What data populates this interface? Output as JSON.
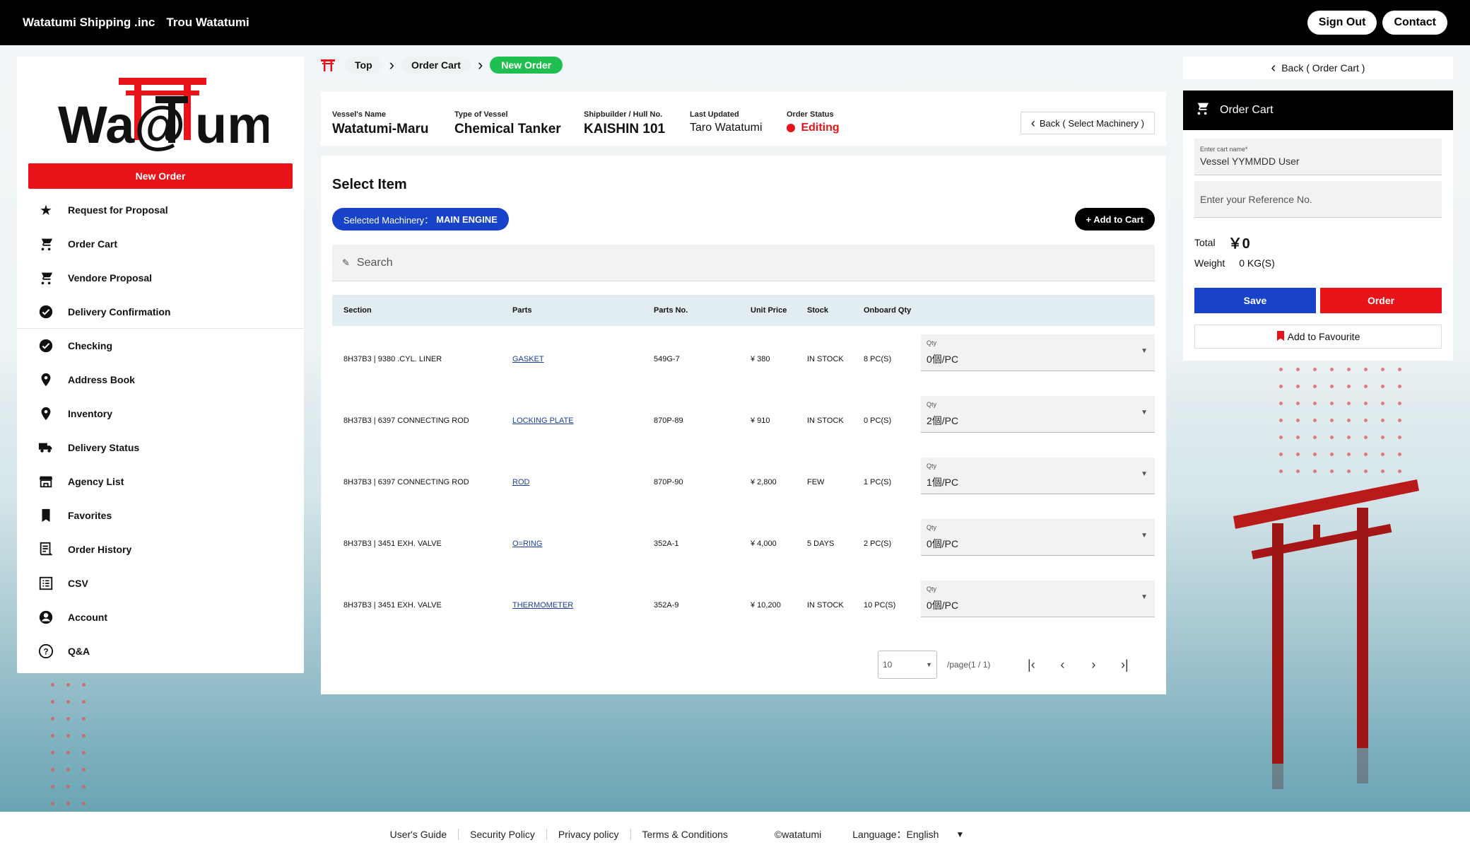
{
  "header": {
    "company": "Watatumi Shipping .inc",
    "user": "Trou Watatumi",
    "sign_out": "Sign Out",
    "contact": "Contact"
  },
  "sidebar": {
    "logo_text": "Wa@umi",
    "new_order": "New Order",
    "items": [
      {
        "label": "Request for Proposal",
        "icon": "star-icon"
      },
      {
        "label": "Order Cart",
        "icon": "cart-icon"
      },
      {
        "label": "Vendore Proposal",
        "icon": "cart-icon"
      },
      {
        "label": "Delivery Confirmation",
        "icon": "check-circle-icon"
      },
      {
        "label": "Checking",
        "icon": "check-circle-icon"
      },
      {
        "label": "Address Book",
        "icon": "location-pin-icon"
      },
      {
        "label": "Inventory",
        "icon": "location-pin-icon"
      },
      {
        "label": "Delivery Status",
        "icon": "truck-icon"
      },
      {
        "label": "Agency List",
        "icon": "store-icon"
      },
      {
        "label": "Favorites",
        "icon": "bookmark-icon"
      },
      {
        "label": "Order History",
        "icon": "receipt-icon"
      },
      {
        "label": "CSV",
        "icon": "list-icon"
      },
      {
        "label": "Account",
        "icon": "account-circle-icon"
      },
      {
        "label": "Q&A",
        "icon": "help-circle-icon"
      }
    ]
  },
  "breadcrumb": {
    "top": "Top",
    "order_cart": "Order Cart",
    "new_order": "New Order"
  },
  "vessel": {
    "name_label": "Vessel's Name",
    "name": "Watatumi-Maru",
    "type_label": "Type of Vessel",
    "type": "Chemical Tanker",
    "builder_label": "Shipbuilder / Hull No.",
    "builder": "KAISHIN 101",
    "updated_label": "Last Updated",
    "updated": "Taro Watatumi",
    "status_label": "Order Status",
    "status": "Editing",
    "back_machinery": "Back ( Select Machinery )"
  },
  "main": {
    "title": "Select Item",
    "selected_machinery_label": "Selected Machinery：",
    "selected_machinery_value": "MAIN ENGINE",
    "add_to_cart": "+ Add to Cart",
    "search_placeholder": "Search"
  },
  "table": {
    "headers": [
      "Section",
      "Parts",
      "Parts No.",
      "Unit Price",
      "Stock",
      "Onboard Qty"
    ],
    "qty_label": "Qty",
    "rows": [
      {
        "section": "8H37B3 | 9380 .CYL. LINER",
        "part": "GASKET",
        "part_no": "549G-7",
        "price": "¥ 380",
        "stock": "IN STOCK",
        "onboard": "8 PC(S)",
        "qty": "0個/PC"
      },
      {
        "section": "8H37B3 | 6397 CONNECTING ROD",
        "part": "LOCKING PLATE",
        "part_no": "870P-89",
        "price": "¥ 910",
        "stock": "IN STOCK",
        "onboard": "0 PC(S)",
        "qty": "2個/PC"
      },
      {
        "section": "8H37B3 | 6397 CONNECTING ROD",
        "part": "ROD",
        "part_no": "870P-90",
        "price": "¥ 2,800",
        "stock": "FEW",
        "onboard": "1 PC(S)",
        "qty": "1個/PC"
      },
      {
        "section": "8H37B3 | 3451 EXH. VALVE",
        "part": "O=RING",
        "part_no": "352A-1",
        "price": "¥ 4,000",
        "stock": "5 DAYS",
        "onboard": "2 PC(S)",
        "qty": "0個/PC"
      },
      {
        "section": "8H37B3 | 3451 EXH. VALVE",
        "part": "THERMOMETER",
        "part_no": "352A-9",
        "price": "¥ 10,200",
        "stock": "IN STOCK",
        "onboard": "10 PC(S)",
        "qty": "0個/PC"
      }
    ]
  },
  "pager": {
    "page_size": "10",
    "page_info": "/page(1 / 1)"
  },
  "cart": {
    "back": "Back ( Order Cart )",
    "title": "Order Cart",
    "name_label": "Enter cart name*",
    "name_value": "Vessel YYMMDD User",
    "ref_placeholder": "Enter your Reference No.",
    "total_label": "Total",
    "total_value": "￥0",
    "weight_label": "Weight",
    "weight_value": "0 KG(S)",
    "save": "Save",
    "order": "Order",
    "favourite": "Add to Favourite"
  },
  "footer": {
    "links": [
      "User's Guide",
      "Security Policy",
      "Privacy policy",
      "Terms & Conditions"
    ],
    "copyright": "©watatumi",
    "language": "Language：English"
  },
  "colors": {
    "brand_red": "#e8141a",
    "brand_blue": "#1742c9",
    "active_green": "#1fbf4f"
  }
}
